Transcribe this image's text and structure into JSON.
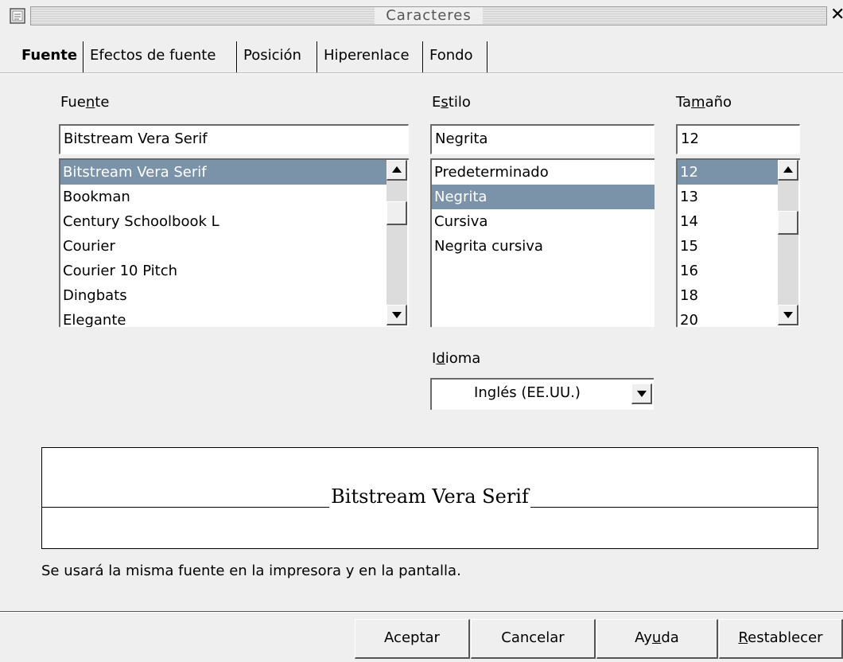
{
  "window": {
    "title": "Caracteres"
  },
  "tabs": [
    {
      "label": "Fuente",
      "active": true
    },
    {
      "label": "Efectos de fuente"
    },
    {
      "label": "Posición"
    },
    {
      "label": "Hiperenlace"
    },
    {
      "label": "Fondo"
    }
  ],
  "font": {
    "label_pre": "Fue",
    "label_mn": "n",
    "label_post": "te",
    "value": "Bitstream Vera Serif",
    "items": [
      "Bitstream Vera Serif",
      "Bookman",
      "Century Schoolbook L",
      "Courier",
      "Courier 10 Pitch",
      "Dingbats",
      "Elegante"
    ],
    "selected": "Bitstream Vera Serif"
  },
  "style": {
    "label_pre": "E",
    "label_mn": "s",
    "label_post": "tilo",
    "value": "Negrita",
    "items": [
      "Predeterminado",
      "Negrita",
      "Cursiva",
      "Negrita cursiva"
    ],
    "selected": "Negrita"
  },
  "size": {
    "label_pre": "Ta",
    "label_mn": "m",
    "label_post": "año",
    "value": "12",
    "items": [
      "12",
      "13",
      "14",
      "15",
      "16",
      "18",
      "20"
    ],
    "selected": "12"
  },
  "language": {
    "label_pre": "I",
    "label_mn": "d",
    "label_post": "ioma",
    "value": "Inglés (EE.UU.)"
  },
  "preview": {
    "text": "Bitstream Vera Serif"
  },
  "info_text": "Se usará la misma fuente en la impresora y en la pantalla.",
  "buttons": {
    "ok": "Aceptar",
    "cancel": "Cancelar",
    "help_pre": "Ay",
    "help_mn": "u",
    "help_post": "da",
    "reset_mn": "R",
    "reset_post": "establecer"
  },
  "colors": {
    "selection": "#7b93a8",
    "background": "#efefef"
  }
}
